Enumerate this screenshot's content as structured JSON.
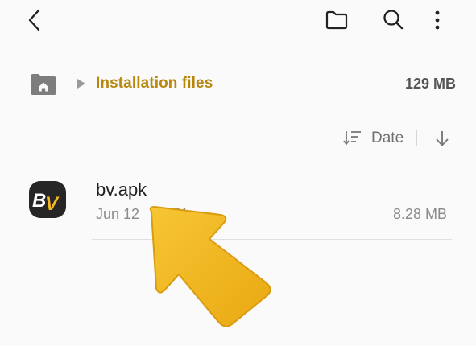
{
  "topbar": {
    "back_icon": "chevron-left-icon",
    "folder_icon": "folder-icon",
    "search_icon": "search-icon",
    "more_icon": "more-vertical-icon"
  },
  "breadcrumb": {
    "home_icon": "home-folder-icon",
    "path_label": "Installation files",
    "total_size": "129 MB"
  },
  "sort": {
    "label": "Date",
    "sort_icon": "sort-lines-icon",
    "direction_icon": "arrow-down-icon"
  },
  "files": [
    {
      "name": "bv.apk",
      "date": "Jun 12",
      "time_fragment": "51",
      "size": "8.28 MB",
      "app_icon_text": "BV"
    }
  ],
  "colors": {
    "accent": "#b7860b",
    "arrow_annotation": "#f2b523"
  }
}
